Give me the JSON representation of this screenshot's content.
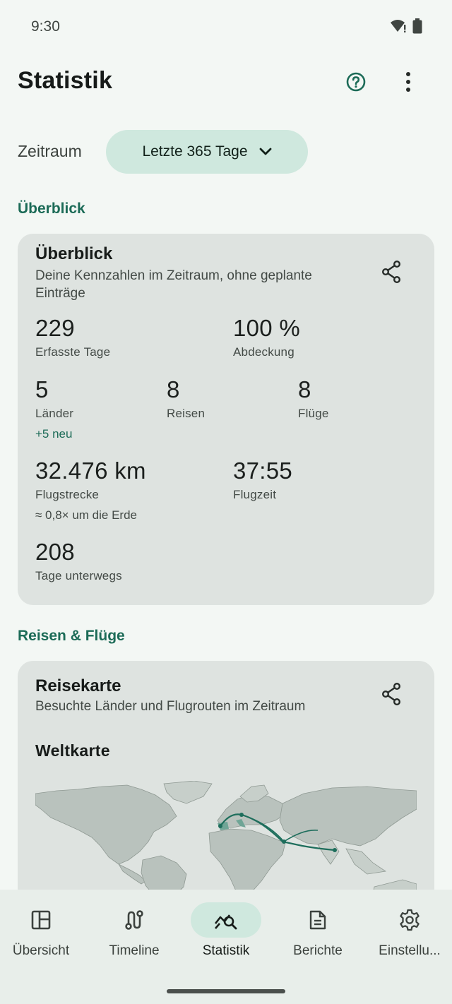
{
  "status_bar": {
    "time": "9:30"
  },
  "app_bar": {
    "title": "Statistik"
  },
  "period": {
    "label": "Zeitraum",
    "selected": "Letzte 365 Tage"
  },
  "sections": {
    "overview": "Überblick",
    "trips": "Reisen & Flüge"
  },
  "overview_card": {
    "title": "Überblick",
    "subtitle": "Deine Kennzahlen im Zeitraum, ohne geplante Einträge",
    "metrics": {
      "days": {
        "value": "229",
        "label": "Erfasste Tage"
      },
      "coverage": {
        "value": "100 %",
        "label": "Abdeckung"
      },
      "countries": {
        "value": "5",
        "label": "Länder",
        "extra": "+5 neu"
      },
      "trips": {
        "value": "8",
        "label": "Reisen"
      },
      "flights": {
        "value": "8",
        "label": "Flüge"
      },
      "distance": {
        "value": "32.476 km",
        "label": "Flugstrecke",
        "extra": "≈ 0,8× um die Erde"
      },
      "flight_time": {
        "value": "37:55",
        "label": "Flugzeit"
      },
      "days_away": {
        "value": "208",
        "label": "Tage unterwegs"
      }
    }
  },
  "map_card": {
    "title": "Reisekarte",
    "subtitle": "Besuchte Länder und Flugrouten im Zeitraum",
    "map_title": "Weltkarte"
  },
  "bottom_nav": {
    "items": [
      {
        "label": "Übersicht",
        "icon": "dashboard-icon"
      },
      {
        "label": "Timeline",
        "icon": "route-icon"
      },
      {
        "label": "Statistik",
        "icon": "query-stats-icon",
        "active": true
      },
      {
        "label": "Berichte",
        "icon": "document-icon"
      },
      {
        "label": "Einstellu...",
        "icon": "gear-icon"
      }
    ]
  },
  "colors": {
    "accent": "#1c6b57",
    "chip": "#cfe8de",
    "card": "#dee3e0",
    "background": "#f3f7f4",
    "route": "#1e6e5c"
  }
}
